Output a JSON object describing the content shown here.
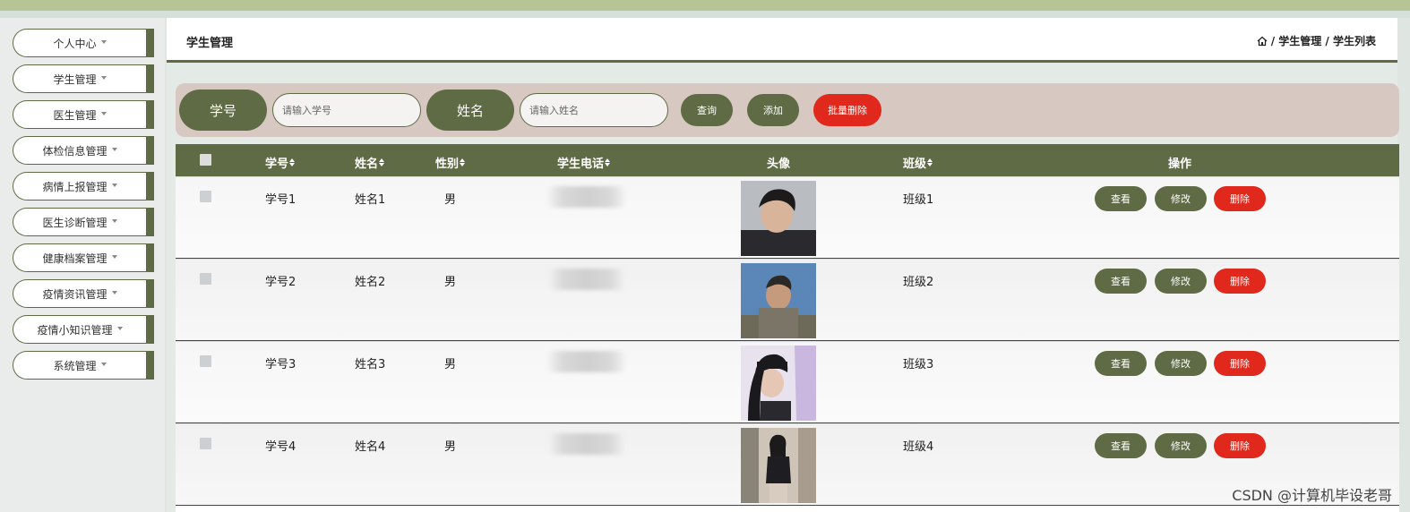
{
  "sidebar": {
    "items": [
      {
        "label": "个人中心"
      },
      {
        "label": "学生管理"
      },
      {
        "label": "医生管理"
      },
      {
        "label": "体检信息管理"
      },
      {
        "label": "病情上报管理"
      },
      {
        "label": "医生诊断管理"
      },
      {
        "label": "健康档案管理"
      },
      {
        "label": "疫情资讯管理"
      },
      {
        "label": "疫情小知识管理"
      },
      {
        "label": "系统管理"
      }
    ]
  },
  "header": {
    "title": "学生管理",
    "breadcrumb": {
      "icon": "home-icon",
      "text": "/ 学生管理 / 学生列表"
    }
  },
  "search": {
    "field1_label": "学号",
    "field1_placeholder": "请输入学号",
    "field2_label": "姓名",
    "field2_placeholder": "请输入姓名",
    "query_label": "查询",
    "add_label": "添加",
    "batch_delete_label": "批量删除"
  },
  "table": {
    "columns": [
      "学号",
      "姓名",
      "性别",
      "学生电话",
      "头像",
      "班级",
      "操作"
    ],
    "rows": [
      {
        "id": "学号1",
        "name": "姓名1",
        "gender": "男",
        "class": "班级1"
      },
      {
        "id": "学号2",
        "name": "姓名2",
        "gender": "男",
        "class": "班级2"
      },
      {
        "id": "学号3",
        "name": "姓名3",
        "gender": "男",
        "class": "班级3"
      },
      {
        "id": "学号4",
        "name": "姓名4",
        "gender": "男",
        "class": "班级4"
      }
    ],
    "actions": {
      "view": "查看",
      "edit": "修改",
      "delete": "删除"
    }
  },
  "watermark": "CSDN @计算机毕设老哥",
  "colors": {
    "primary": "#5f6b44",
    "danger": "#e0281c",
    "searchbar_bg": "#d7c8c2",
    "top_strip": "#b7c596"
  }
}
